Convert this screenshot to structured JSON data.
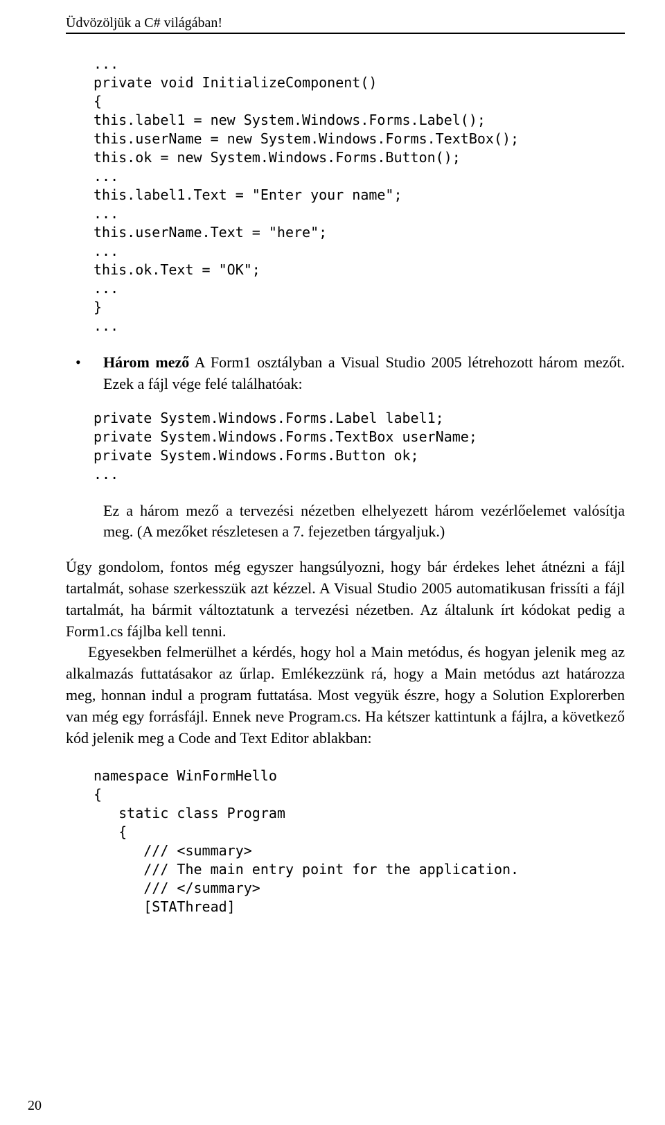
{
  "header": "Üdvözöljük a C# világában!",
  "code1": "...\nprivate void InitializeComponent()\n{\nthis.label1 = new System.Windows.Forms.Label();\nthis.userName = new System.Windows.Forms.TextBox();\nthis.ok = new System.Windows.Forms.Button();\n...\nthis.label1.Text = \"Enter your name\";\n...\nthis.userName.Text = \"here\";\n...\nthis.ok.Text = \"OK\";\n...\n}\n...",
  "bullet1": {
    "strong": "Három mező",
    "rest": " A Form1 osztályban a Visual Studio 2005 létrehozott három mezőt. Ezek a fájl vége felé találhatóak:"
  },
  "code2": "private System.Windows.Forms.Label label1;\nprivate System.Windows.Forms.TextBox userName;\nprivate System.Windows.Forms.Button ok;\n...",
  "bullet1b": "Ez a három mező a tervezési nézetben elhelyezett három vezérlőelemet valósítja meg. (A mezőket részletesen a 7. fejezetben tárgyaljuk.)",
  "para1": "Úgy gondolom, fontos még egyszer hangsúlyozni, hogy bár érdekes lehet átnézni a fájl tartalmát, sohase szerkesszük azt kézzel. A Visual Studio 2005 automatikusan frissíti a fájl tartalmát, ha bármit változtatunk a tervezési nézetben. Az általunk írt kódokat pedig a Form1.cs fájlba kell tenni.",
  "para2": "Egyesekben felmerülhet a kérdés, hogy hol a Main metódus, és hogyan jelenik meg az alkalmazás futtatásakor az űrlap. Emlékezzünk rá, hogy a Main metódus azt határozza meg, honnan indul a program futtatása. Most vegyük észre, hogy a Solution Explorerben van még egy forrásfájl. Ennek neve Program.cs. Ha kétszer kattintunk a fájlra, a következő kód jelenik meg a Code and Text Editor ablakban:",
  "code3": "namespace WinFormHello\n{\n   static class Program\n   {\n      /// <summary>\n      /// The main entry point for the application.\n      /// </summary>\n      [STAThread]",
  "pagenum": "20"
}
